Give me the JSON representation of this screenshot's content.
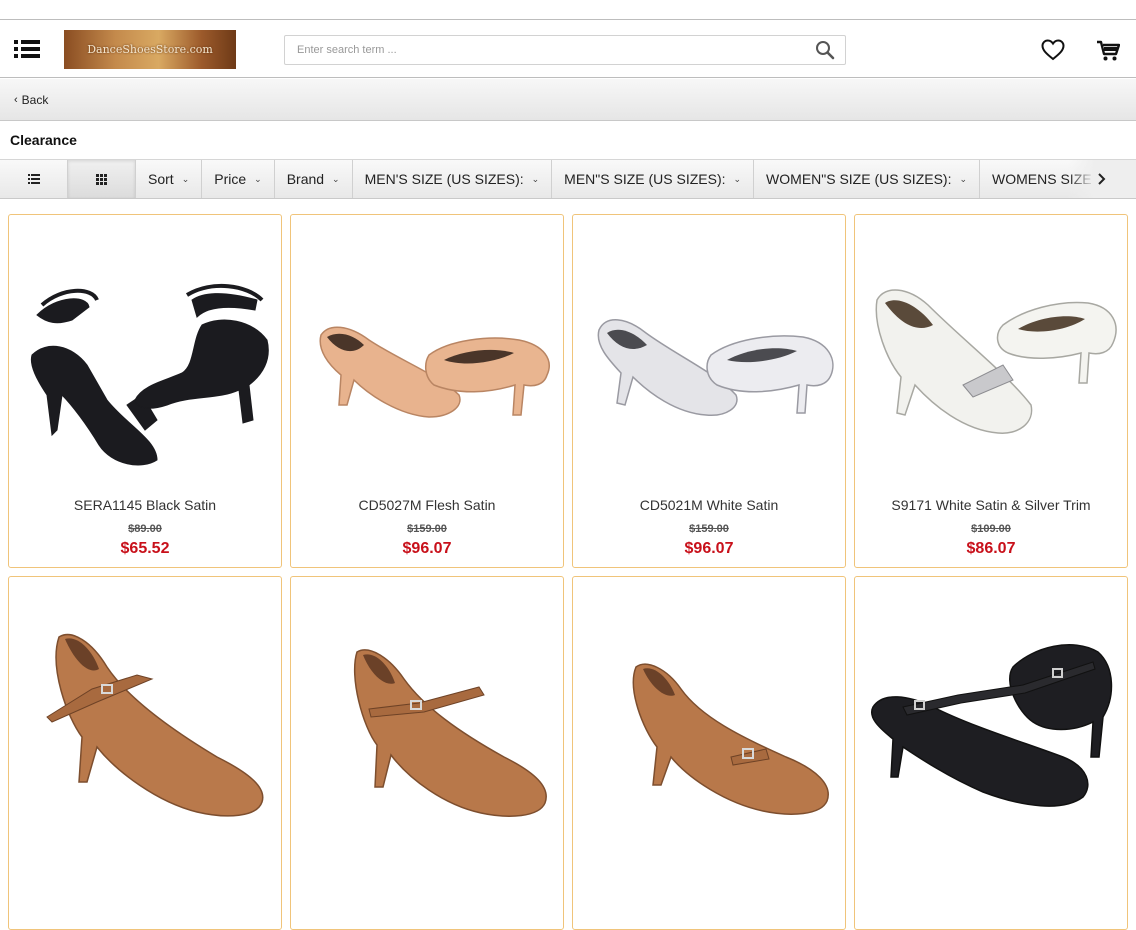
{
  "header": {
    "logo_text": "DanceShoesStore.com",
    "search_placeholder": "Enter search term ..."
  },
  "nav": {
    "back_label": "Back"
  },
  "page": {
    "title": "Clearance"
  },
  "filters": {
    "items": [
      "Sort",
      "Price",
      "Brand",
      "MEN'S SIZE (US SIZES):",
      "MEN\"S SIZE (US SIZES):",
      "WOMEN\"S SIZE (US SIZES):",
      "WOMENS SIZE (US"
    ]
  },
  "products": [
    {
      "name": "SERA1145 Black Satin",
      "old_price": "$89.00",
      "price": "$65.52",
      "image": "black-strappy-sandal"
    },
    {
      "name": "CD5027M Flesh Satin",
      "old_price": "$159.00",
      "price": "$96.07",
      "image": "flesh-satin-pump"
    },
    {
      "name": "CD5021M White Satin",
      "old_price": "$159.00",
      "price": "$96.07",
      "image": "white-satin-pump"
    },
    {
      "name": "S9171 White Satin & Silver Trim",
      "old_price": "$109.00",
      "price": "$86.07",
      "image": "white-satin-silver-trim-pump"
    },
    {
      "name": "",
      "old_price": "",
      "price": "",
      "image": "tan-satin-strap-pump"
    },
    {
      "name": "",
      "old_price": "",
      "price": "",
      "image": "tan-satin-strap-pump-2"
    },
    {
      "name": "",
      "old_price": "",
      "price": "",
      "image": "tan-satin-buckle-pump"
    },
    {
      "name": "",
      "old_price": "",
      "price": "",
      "image": "black-cross-strap-shoe"
    }
  ],
  "colors": {
    "accent_price": "#c8101a",
    "card_border": "#f0c47a"
  }
}
